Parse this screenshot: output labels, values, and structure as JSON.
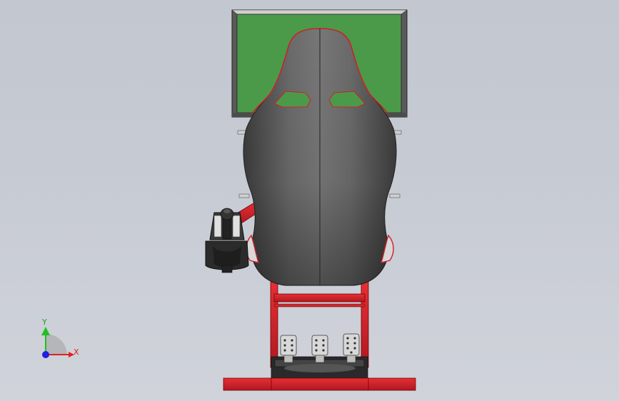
{
  "viewport": {
    "background_top": "#c3c7d0",
    "background_bottom": "#d0d3da"
  },
  "triad": {
    "x_label": "X",
    "y_label": "Y",
    "x_color": "#e02020",
    "y_color": "#20c020",
    "z_color": "#2020e0"
  },
  "model": {
    "monitor_screen_color": "#4a9a4a",
    "frame_color": "#d0202a",
    "seat_color": "#5a5a5a"
  }
}
